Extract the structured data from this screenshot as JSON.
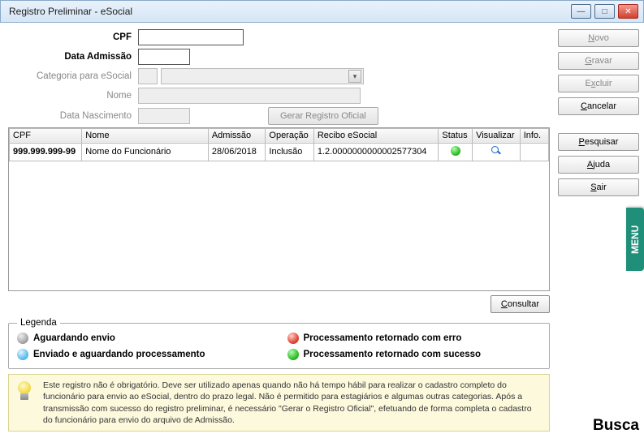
{
  "window": {
    "title": "Registro Preliminar - eSocial"
  },
  "form": {
    "labels": {
      "cpf": "CPF",
      "data_admissao": "Data Admissão",
      "categoria": "Categoria para eSocial",
      "nome": "Nome",
      "data_nascimento": "Data Nascimento"
    },
    "values": {
      "cpf": "",
      "data_admissao": "",
      "categoria": "",
      "nome": "",
      "data_nascimento": ""
    },
    "btn_gerar": "Gerar Registro Oficial"
  },
  "side_buttons": {
    "novo": "Novo",
    "gravar": "Gravar",
    "excluir": "Excluir",
    "cancelar": "Cancelar",
    "pesquisar": "Pesquisar",
    "ajuda": "Ajuda",
    "sair": "Sair"
  },
  "grid": {
    "columns": {
      "cpf": "CPF",
      "nome": "Nome",
      "admissao": "Admissão",
      "operacao": "Operação",
      "recibo": "Recibo eSocial",
      "status": "Status",
      "visualizar": "Visualizar",
      "info": "Info."
    },
    "rows": [
      {
        "cpf": "999.999.999-99",
        "nome": "Nome do Funcionário",
        "admissao": "28/06/2018",
        "operacao": "Inclusão",
        "recibo": "1.2.0000000000002577304"
      }
    ]
  },
  "consultar": "Consultar",
  "legend": {
    "title": "Legenda",
    "items": {
      "aguardando": "Aguardando envio",
      "enviado": "Enviado e aguardando processamento",
      "erro": "Processamento retornado com erro",
      "sucesso": "Processamento retornado com sucesso"
    }
  },
  "info_text": "Este registro não é obrigatório. Deve ser utilizado apenas quando não há tempo hábil para realizar o cadastro completo do funcionário para envio ao eSocial, dentro do prazo legal. Não é permitido para estagiários e algumas outras categorias. Após a transmissão com sucesso do registro preliminar, é necessário \"Gerar o Registro Oficial\", efetuando de forma completa o cadastro do funcionário para envio do arquivo de Admissão.",
  "busca": "Busca",
  "menu_label": "MENU"
}
